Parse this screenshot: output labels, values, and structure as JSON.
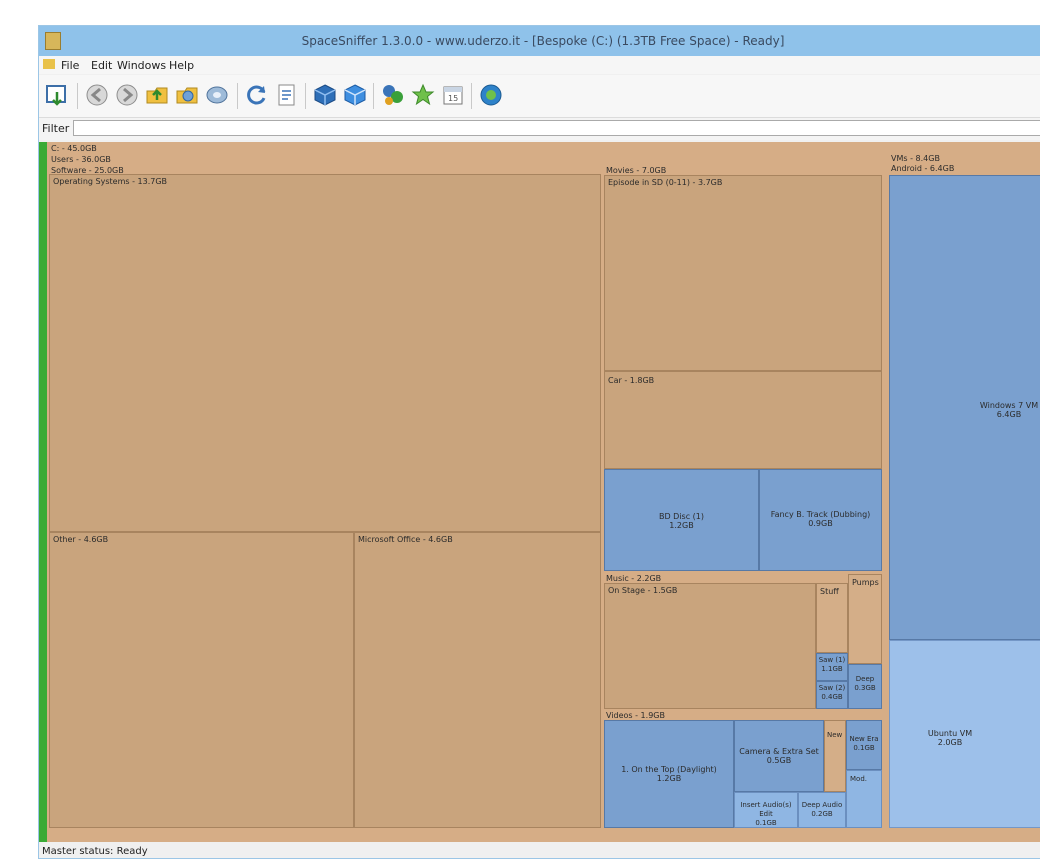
{
  "window": {
    "title": "SpaceSniffer 1.3.0.0 - www.uderzo.it - [Bespoke (C:) (1.3TB Free Space) - Ready]"
  },
  "menu": {
    "file": "File",
    "edit": "Edit",
    "windows": "Windows",
    "help": "Help"
  },
  "toolbar": {
    "icons": [
      "new-scan-icon",
      "back-icon",
      "forward-icon",
      "up-folder-icon",
      "refresh-icon",
      "rescan-icon",
      "export-icon",
      "box-icon",
      "cube-icon",
      "tags-icon",
      "star-icon",
      "calendar-icon",
      "info-icon"
    ]
  },
  "filter": {
    "label": "Filter",
    "value": ""
  },
  "treemap": {
    "root": "C: - 45.0GB",
    "users": "Users - 36.0GB",
    "software": "Software - 25.0GB",
    "operating_systems": "Operating Systems - 13.7GB",
    "other": "Other - 4.6GB",
    "microsoft_office": "Microsoft Office - 4.6GB",
    "movies": "Movies - 7.0GB",
    "episode": "Episode in SD (0-11) - 3.7GB",
    "car": "Car - 1.8GB",
    "bluray": "BD Disc (1)\n1.2GB",
    "fancy_track": "Fancy B. Track (Dubbing) 0.9GB",
    "music": "Music - 2.2GB",
    "on_stage": "On Stage - 1.5GB",
    "misc1": "Stuff",
    "misc2": "Pumps",
    "sw_a": "Saw (1)\n1.1GB",
    "sw_b": "Saw (2)\n0.4GB",
    "sw_c": "Deep\n0.3GB",
    "videos": "Videos - 1.9GB",
    "first_video": "1. On the Top (Daylight)\n1.2GB",
    "camera": "Camera & Extra Set\n0.5GB",
    "small1": "New",
    "small2": "Mod.",
    "small3": "Deep Audio\n0.2GB",
    "small4": "Insert Audio(s) Edit\n0.1GB",
    "small5": "New Era\n0.1GB",
    "vm": "VMs - 8.4GB",
    "vm_sub": "Android - 6.4GB",
    "windows7": "Windows 7 VM\n6.4GB",
    "ios": "Ubuntu VM\n2.0GB"
  },
  "status": {
    "text": "Master status: Ready"
  },
  "colors": {
    "titlebar": "#8fc2ea",
    "folder": "#d6ad86",
    "file": "#7aa0cf",
    "green": "#3aaa35"
  }
}
